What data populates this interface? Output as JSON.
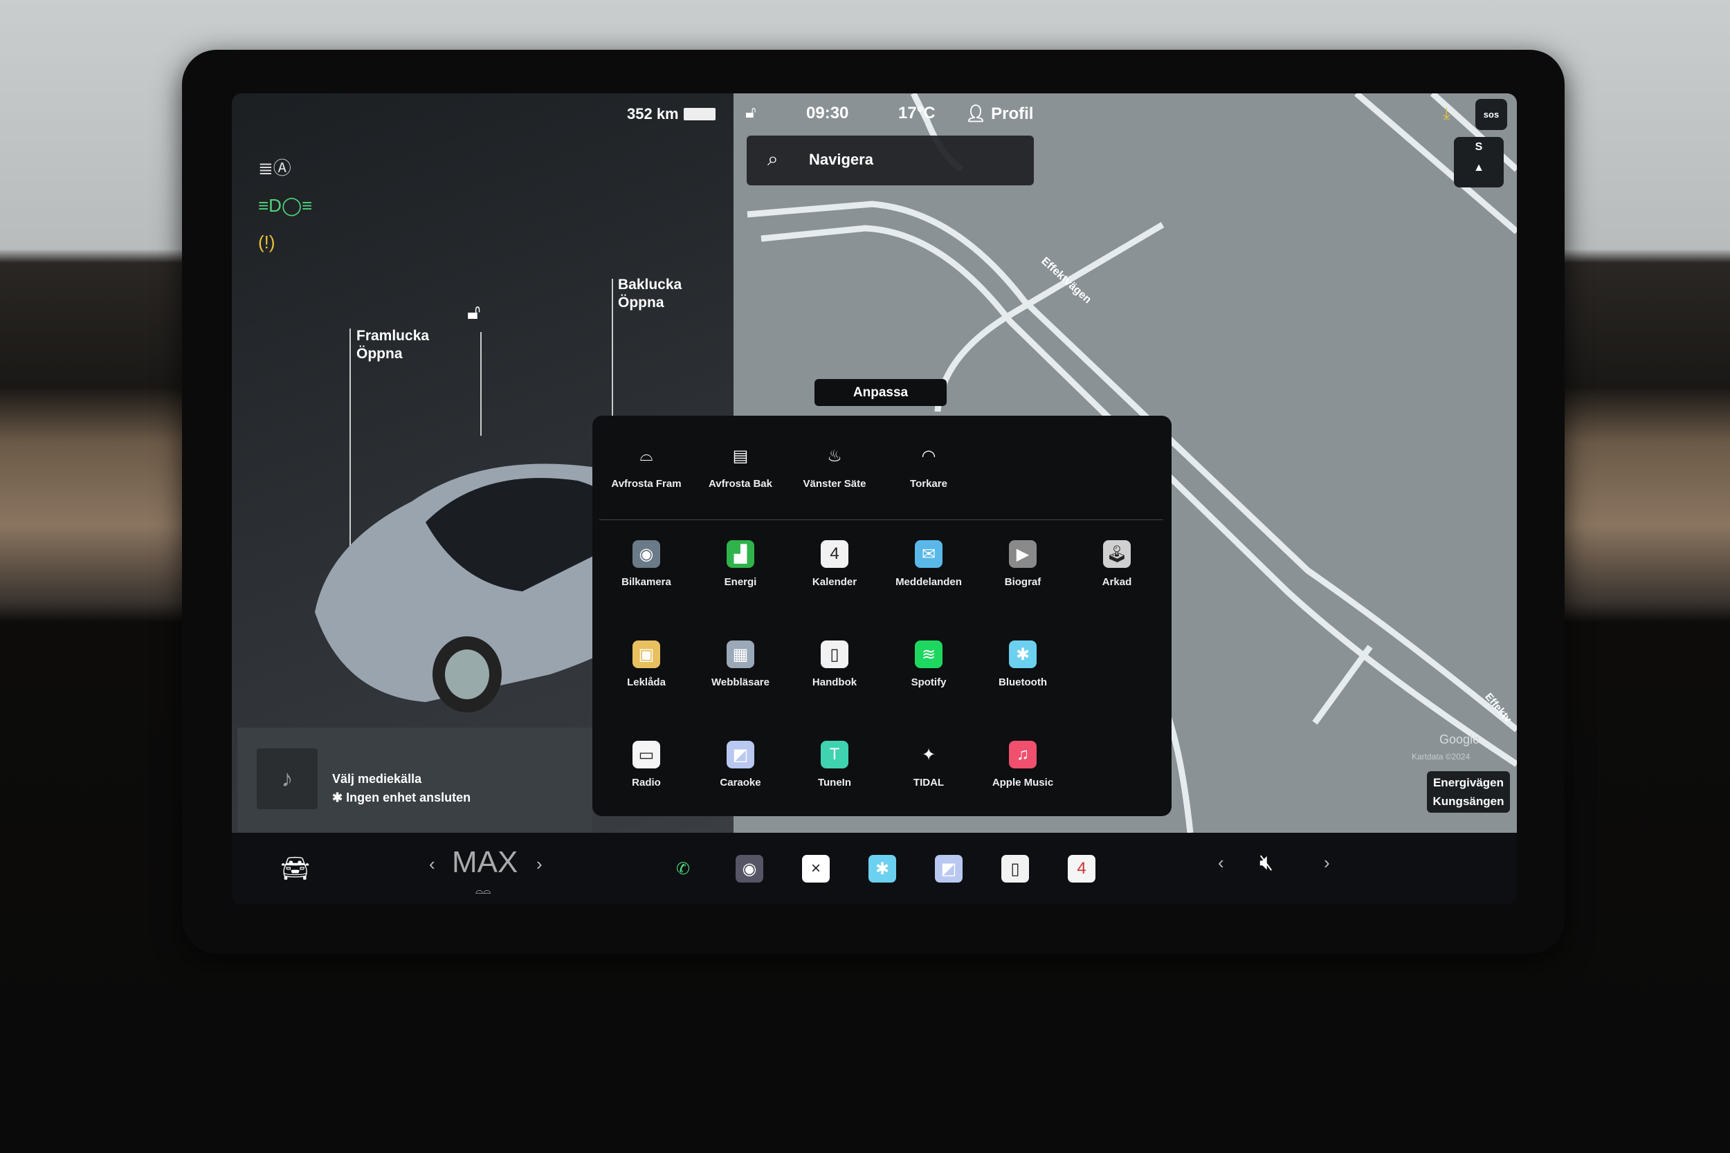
{
  "status": {
    "range": "352 km",
    "time": "09:30",
    "temperature": "17°C",
    "profile": "Profil"
  },
  "search": {
    "placeholder": "Navigera"
  },
  "map": {
    "street_top": "Effektvägen",
    "street_edge": "Effektv",
    "google": "Google",
    "map_data": "Kartdata ©2024",
    "location_line1": "Energivägen",
    "location_line2": "Kungsängen",
    "compass_letters": "S",
    "sos": "SOS"
  },
  "car": {
    "front_trunk": "Framlucka",
    "front_trunk_action": "Öppna",
    "rear_trunk": "Baklucka",
    "rear_trunk_action": "Öppna"
  },
  "media": {
    "title": "Välj mediekälla",
    "subtitle": "Ingen enhet ansluten"
  },
  "customize_button": "Anpassa",
  "quick_controls": [
    {
      "label": "Avfrosta Fram",
      "icon": "front-defrost-icon"
    },
    {
      "label": "Avfrosta Bak",
      "icon": "rear-defrost-icon"
    },
    {
      "label": "Vänster Säte",
      "icon": "seat-heater-icon"
    },
    {
      "label": "Torkare",
      "icon": "wiper-icon"
    }
  ],
  "apps": [
    {
      "label": "Bilkamera",
      "icon": "camera-icon",
      "color": "#6a7a88"
    },
    {
      "label": "Energi",
      "icon": "energy-icon",
      "color": "#2fb34a"
    },
    {
      "label": "Kalender",
      "icon": "calendar-icon",
      "color": "#f2f2f2"
    },
    {
      "label": "Meddelanden",
      "icon": "messages-icon",
      "color": "#5ab8e8"
    },
    {
      "label": "Biograf",
      "icon": "theater-icon",
      "color": "#8a8a8a"
    },
    {
      "label": "Arkad",
      "icon": "arcade-icon",
      "color": "#d0d0d0"
    },
    {
      "label": "Leklåda",
      "icon": "toybox-icon",
      "color": "#e8c060"
    },
    {
      "label": "Webbläsare",
      "icon": "browser-icon",
      "color": "#9aa8b8"
    },
    {
      "label": "Handbok",
      "icon": "manual-icon",
      "color": "#f2f2f2"
    },
    {
      "label": "Spotify",
      "icon": "spotify-icon",
      "color": "#1ed760"
    },
    {
      "label": "Bluetooth",
      "icon": "bluetooth-icon",
      "color": "#6cd0f0"
    },
    {
      "label": "Radio",
      "icon": "radio-icon",
      "color": "#f5f5f5"
    },
    {
      "label": "Caraoke",
      "icon": "caraoke-icon",
      "color": "#b8c8f0"
    },
    {
      "label": "TuneIn",
      "icon": "tunein-icon",
      "color": "#3fd3b0"
    },
    {
      "label": "TIDAL",
      "icon": "tidal-icon",
      "color": "#ffffff"
    },
    {
      "label": "Apple Music",
      "icon": "apple-music-icon",
      "color": "#f0506e"
    }
  ],
  "bottom": {
    "fan": "MAX",
    "dock": [
      "phone-icon",
      "camera-app-icon",
      "close-app-icon",
      "bluetooth-icon",
      "caraoke-icon",
      "manual-icon",
      "calendar-icon"
    ]
  },
  "colors": {
    "accent_green": "#4fd47a",
    "warning_yellow": "#e8c23a"
  }
}
